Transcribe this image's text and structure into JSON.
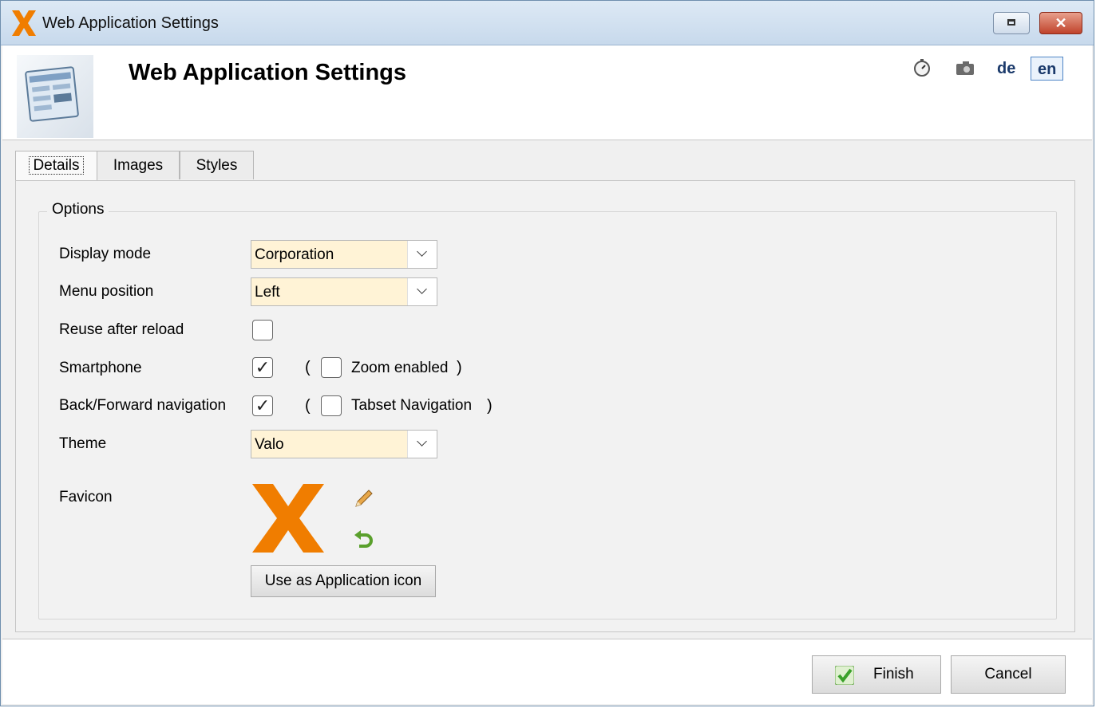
{
  "window": {
    "title": "Web Application Settings",
    "close_glyph": "✕"
  },
  "header": {
    "title": "Web Application Settings",
    "languages": [
      "de",
      "en"
    ],
    "active_language": "en"
  },
  "tabs": [
    {
      "label": "Details",
      "selected": true
    },
    {
      "label": "Images",
      "selected": false
    },
    {
      "label": "Styles",
      "selected": false
    }
  ],
  "options": {
    "group_label": "Options",
    "display_mode": {
      "label": "Display mode",
      "value": "Corporation"
    },
    "menu_position": {
      "label": "Menu position",
      "value": "Left"
    },
    "reuse_after_reload": {
      "label": "Reuse after reload",
      "checked": false
    },
    "smartphone": {
      "label": "Smartphone",
      "checked": true,
      "check_glyph": "✓"
    },
    "zoom_enabled": {
      "label": "Zoom enabled",
      "checked": false
    },
    "back_forward": {
      "label": "Back/Forward navigation",
      "checked": true,
      "check_glyph": "✓"
    },
    "tabset_navigation": {
      "label": "Tabset Navigation",
      "checked": false
    },
    "theme": {
      "label": "Theme",
      "value": "Valo"
    },
    "favicon": {
      "label": "Favicon"
    },
    "use_as_app_icon": "Use as Application icon",
    "paren_open": "(",
    "paren_close": ")"
  },
  "footer": {
    "finish": "Finish",
    "cancel": "Cancel"
  },
  "colors": {
    "brand_orange": "#f07d00",
    "combo_bg": "#fff3d6",
    "lang_active_border": "#4f86c6",
    "finish_green": "#3aa12a"
  },
  "icons": {
    "app_logo": "x-logo-icon",
    "header": "settings-window-icon",
    "stopwatch": "stopwatch-icon",
    "camera": "camera-icon",
    "edit": "pencil-icon",
    "reset": "undo-arrow-icon",
    "finish": "checkmark-icon"
  }
}
